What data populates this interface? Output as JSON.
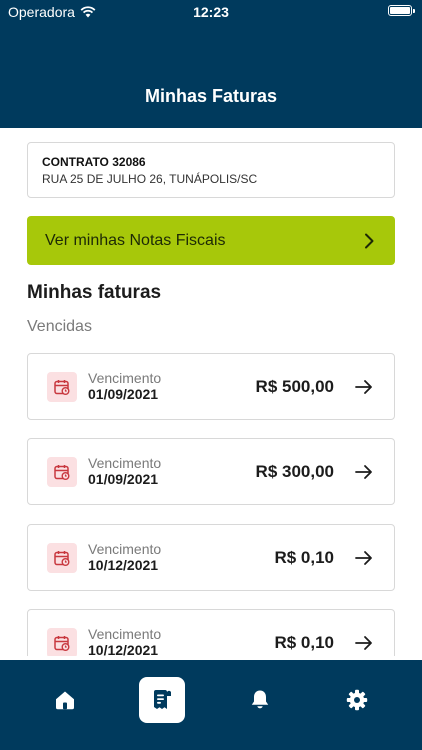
{
  "status_bar": {
    "carrier": "Operadora",
    "time": "12:23"
  },
  "header": {
    "title": "Minhas Faturas"
  },
  "contract": {
    "title": "CONTRATO 32086",
    "address": "RUA 25 DE JULHO 26, TUNÁPOLIS/SC"
  },
  "invoice_link": {
    "label": "Ver minhas Notas Fiscais"
  },
  "bills_section": {
    "title": "Minhas faturas",
    "subtitle": "Vencidas",
    "items": [
      {
        "due_label": "Vencimento",
        "due_date": "01/09/2021",
        "amount": "R$ 500,00"
      },
      {
        "due_label": "Vencimento",
        "due_date": "01/09/2021",
        "amount": "R$ 300,00"
      },
      {
        "due_label": "Vencimento",
        "due_date": "10/12/2021",
        "amount": "R$ 0,10"
      },
      {
        "due_label": "Vencimento",
        "due_date": "10/12/2021",
        "amount": "R$ 0,10"
      }
    ]
  },
  "tab_bar": {
    "tabs": [
      {
        "icon": "home-icon",
        "active": false
      },
      {
        "icon": "receipt-icon",
        "active": true
      },
      {
        "icon": "bell-icon",
        "active": false
      },
      {
        "icon": "gear-icon",
        "active": false
      }
    ]
  },
  "colors": {
    "brand_dark": "#003a5d",
    "accent_green": "#a7c80a",
    "overdue_icon_bg": "#fbe0e2",
    "overdue_icon": "#c8383f"
  }
}
